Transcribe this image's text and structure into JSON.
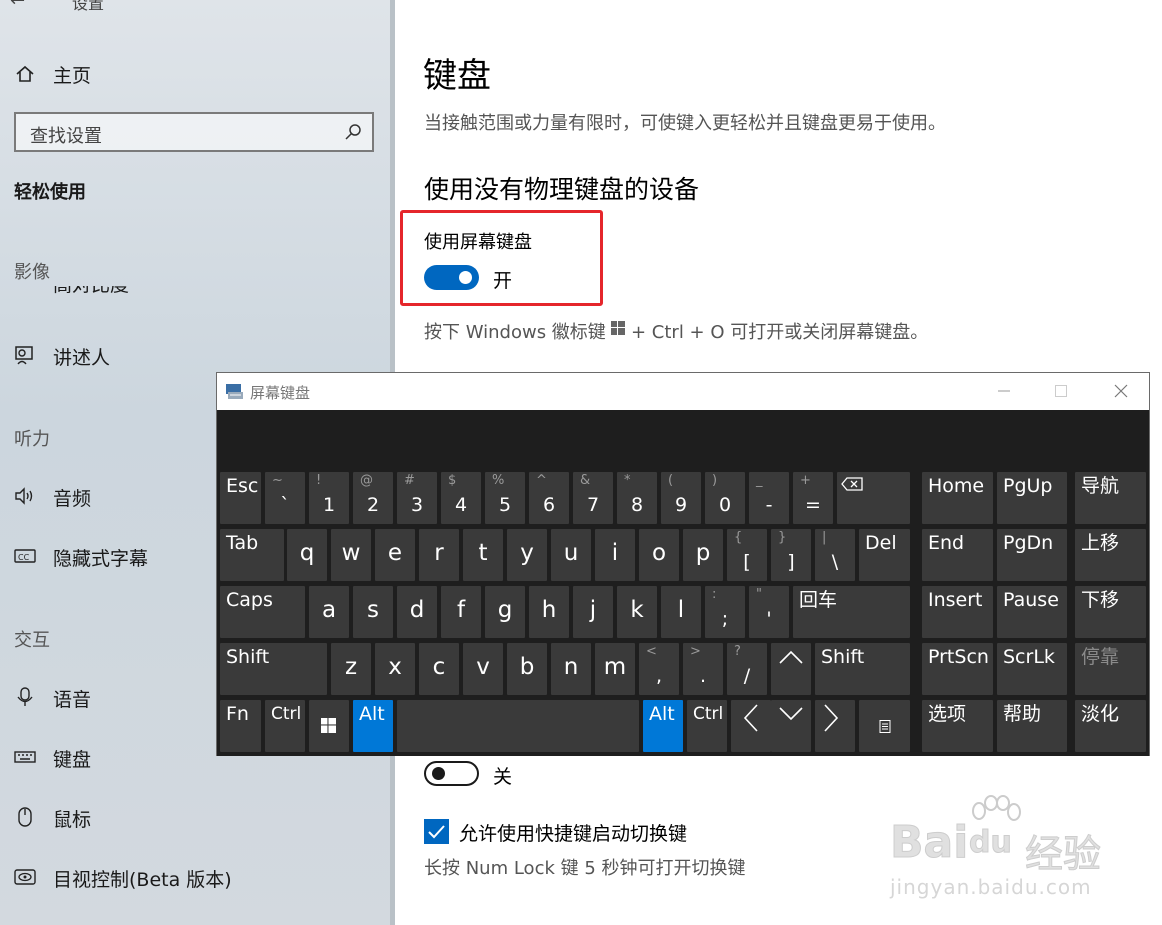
{
  "sidebar": {
    "back_title": "设置",
    "home": "主页",
    "search_placeholder": "查找设置",
    "category": "轻松使用",
    "vision_heading": "影像",
    "partial_item": "高对比度",
    "narrator": "讲述人",
    "hearing_heading": "听力",
    "audio": "音频",
    "captions": "隐藏式字幕",
    "interaction_heading": "交互",
    "speech": "语音",
    "keyboard": "键盘",
    "mouse": "鼠标",
    "eye_control": "目视控制(Beta 版本)"
  },
  "main": {
    "title": "键盘",
    "description": "当接触范围或力量有限时，可使键入更轻松并且键盘更易于使用。",
    "section_heading": "使用没有物理键盘的设备",
    "osk_setting_label": "使用屏幕键盘",
    "osk_toggle_state": "开",
    "osk_toggle_on": true,
    "hint_prefix": "按下 Windows 徽标键",
    "hint_suffix": "+ Ctrl + O 可打开或关闭屏幕键盘。",
    "sticky_toggle_state": "关",
    "sticky_toggle_on": false,
    "shortcut_checkbox_label": "允许使用快捷键启动切换键",
    "shortcut_checkbox_checked": true,
    "numlock_hint": "长按 Num Lock 键 5 秒钟可打开切换键"
  },
  "osk": {
    "title": "屏幕键盘",
    "keys": {
      "esc": "Esc",
      "tab": "Tab",
      "caps": "Caps",
      "shift": "Shift",
      "fn": "Fn",
      "ctrl": "Ctrl",
      "alt": "Alt",
      "del": "Del",
      "enter": "回车",
      "shift_r": "Shift",
      "alt_r": "Alt",
      "ctrl_r": "Ctrl",
      "home": "Home",
      "pgup": "PgUp",
      "nav": "导航",
      "end": "End",
      "pgdn": "PgDn",
      "move_up": "上移",
      "insert": "Insert",
      "pause": "Pause",
      "move_down": "下移",
      "prtscn": "PrtScn",
      "scrlk": "ScrLk",
      "dock": "停靠",
      "options": "选项",
      "help": "帮助",
      "fade": "淡化",
      "row1": [
        {
          "top": "~",
          "bot": "`"
        },
        {
          "top": "!",
          "bot": "1"
        },
        {
          "top": "@",
          "bot": "2"
        },
        {
          "top": "#",
          "bot": "3"
        },
        {
          "top": "$",
          "bot": "4"
        },
        {
          "top": "%",
          "bot": "5"
        },
        {
          "top": "^",
          "bot": "6"
        },
        {
          "top": "&",
          "bot": "7"
        },
        {
          "top": "*",
          "bot": "8"
        },
        {
          "top": "(",
          "bot": "9"
        },
        {
          "top": ")",
          "bot": "0"
        },
        {
          "top": "_",
          "bot": "-"
        },
        {
          "top": "+",
          "bot": "="
        }
      ],
      "row2": [
        "q",
        "w",
        "e",
        "r",
        "t",
        "y",
        "u",
        "i",
        "o",
        "p"
      ],
      "row2_sym": [
        {
          "top": "{",
          "bot": "["
        },
        {
          "top": "}",
          "bot": "]"
        },
        {
          "top": "|",
          "bot": "\\"
        }
      ],
      "row3": [
        "a",
        "s",
        "d",
        "f",
        "g",
        "h",
        "j",
        "k",
        "l"
      ],
      "row3_sym": [
        {
          "top": ":",
          "bot": ";"
        },
        {
          "top": "\"",
          "bot": "'"
        }
      ],
      "row4": [
        "z",
        "x",
        "c",
        "v",
        "b",
        "n",
        "m"
      ],
      "row4_sym": [
        {
          "top": "<",
          "bot": ","
        },
        {
          "top": ">",
          "bot": "."
        },
        {
          "top": "?",
          "bot": "/"
        }
      ]
    }
  },
  "watermark": {
    "brand": "Bai",
    "brand_du": "du",
    "brand_cn": "经验",
    "url": "jingyan.baidu.com"
  }
}
